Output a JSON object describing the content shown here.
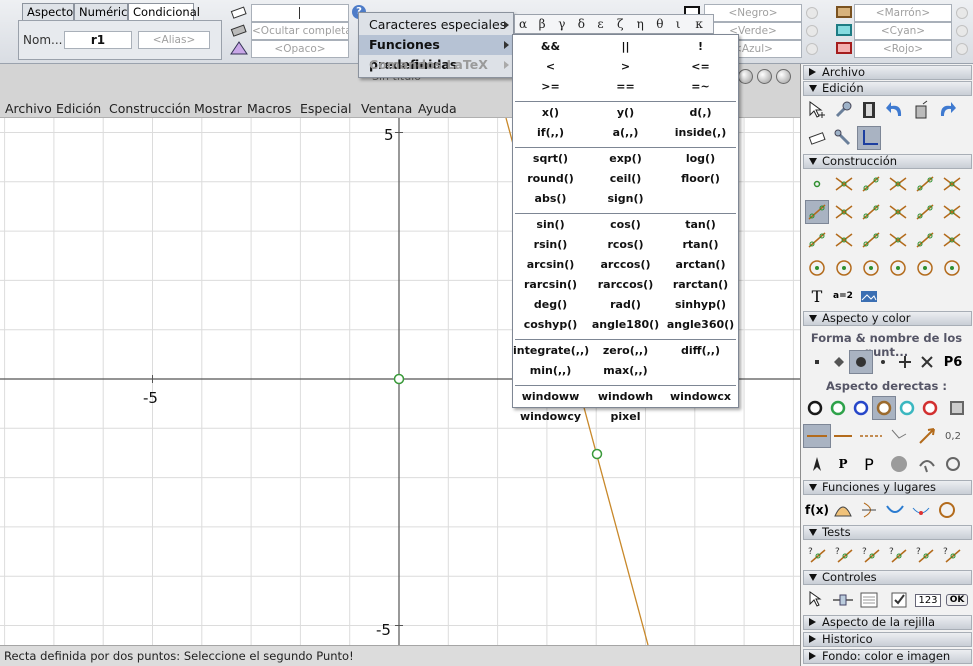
{
  "inspector": {
    "tabs": [
      "Aspecto",
      "Numérico",
      "Condicional"
    ],
    "name_label": "Nom...",
    "name_value": "r1",
    "alias_placeholder": "<Alias>",
    "hide_field": "<Ocultar completam",
    "opacity_field": "<Opaco>",
    "color_fields": [
      "<Negro>",
      "<Verde>",
      "<Azul>",
      "<Marrón>",
      "<Cyan>",
      "<Rojo>"
    ],
    "colors": {
      "black": "#1a1a1a",
      "green": "#2ea24a",
      "blue": "#2747c9",
      "brown": "#9b6a2d",
      "cyan": "#3bb7c0",
      "red": "#d23030"
    },
    "window_title_fragment": "Sin título"
  },
  "menubar": {
    "items": [
      "Archivo",
      "Edición",
      "Construcción",
      "Mostrar",
      "Macros",
      "Especial",
      "Ventana",
      "Ayuda"
    ]
  },
  "graph": {
    "y_top_label": "5",
    "y_bottom_label": "-5",
    "x_left_label": "-5",
    "line_color": "#c8882a",
    "point_color": "#3a9a3a"
  },
  "status": "Recta definida por dos puntos: Seleccione el segundo Punto!",
  "popup_main": {
    "items": [
      {
        "label": "Caracteres especiales",
        "enabled": true,
        "highlighted": false
      },
      {
        "label": "Funciones predefinidas",
        "enabled": true,
        "highlighted": true
      },
      {
        "label": "Comandos LaTeX",
        "enabled": false,
        "highlighted": false
      }
    ]
  },
  "greek_letters": [
    "α",
    "β",
    "γ",
    "δ",
    "ε",
    "ζ",
    "η",
    "θ",
    "ι",
    "κ"
  ],
  "functions": {
    "groups": [
      [
        [
          "&&",
          "||",
          "!"
        ],
        [
          "<",
          ">",
          "<="
        ],
        [
          ">=",
          "==",
          "=~"
        ]
      ],
      [
        [
          "x()",
          "y()",
          "d(,)"
        ],
        [
          "if(,,)",
          "a(,,)",
          "inside(,)"
        ]
      ],
      [
        [
          "sqrt()",
          "exp()",
          "log()"
        ],
        [
          "round()",
          "ceil()",
          "floor()"
        ],
        [
          "abs()",
          "sign()",
          ""
        ]
      ],
      [
        [
          "sin()",
          "cos()",
          "tan()"
        ],
        [
          "rsin()",
          "rcos()",
          "rtan()"
        ],
        [
          "arcsin()",
          "arccos()",
          "arctan()"
        ],
        [
          "rarcsin()",
          "rarccos()",
          "rarctan()"
        ],
        [
          "deg()",
          "rad()",
          "sinhyp()"
        ],
        [
          "coshyp()",
          "angle180()",
          "angle360()"
        ]
      ],
      [
        [
          "integrate(,,)",
          "zero(,,)",
          "diff(,,)"
        ],
        [
          "min(,,)",
          "max(,,)",
          ""
        ]
      ],
      [
        [
          "windoww",
          "windowh",
          "windowcx"
        ],
        [
          "windowcy",
          "pixel",
          ""
        ]
      ]
    ]
  },
  "panel": {
    "sections": {
      "archivo": "Archivo",
      "edicion": "Edición",
      "construccion": "Construcción",
      "aspecto": "Aspecto y color",
      "funciones": "Funciones y lugares",
      "tests": "Tests",
      "controles": "Controles",
      "rejilla": "Aspecto de la rejilla",
      "historico": "Historico",
      "fondo": "Fondo: color e imagen"
    },
    "shape_header": "Forma & nombre de los punt...",
    "line_header": "Aspecto derectas :",
    "point_name_p6": "P6",
    "label_123": "123",
    "label_ok": "OK",
    "label_fx": "f(x)",
    "label_t": "T",
    "label_a2": "a=2",
    "label_p1": "P",
    "label_p2": "P",
    "label_02": "0,2"
  }
}
